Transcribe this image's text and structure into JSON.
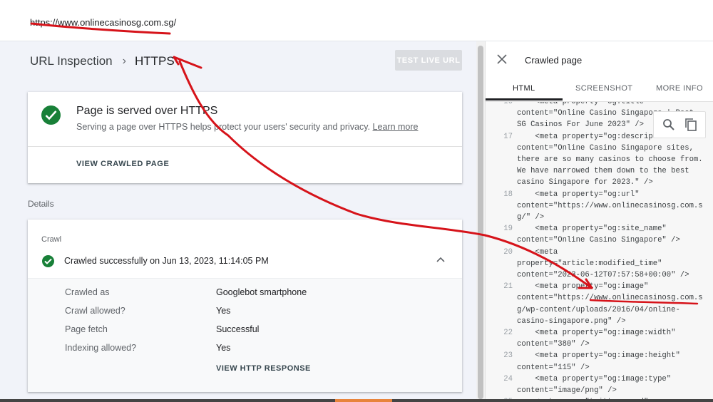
{
  "topbar": {
    "url": "https://www.onlinecasinosg.com.sg/"
  },
  "breadcrumb": {
    "root": "URL Inspection",
    "sep": "›",
    "current": "HTTPS"
  },
  "test_live_url": "TEST LIVE URL",
  "https_card": {
    "title": "Page is served over HTTPS",
    "description": "Serving a page over HTTPS helps protect your users' security and privacy.",
    "learn_more": "Learn more",
    "view_crawled": "VIEW CRAWLED PAGE"
  },
  "details_label": "Details",
  "crawl_card": {
    "label": "Crawl",
    "status": "Crawled successfully on Jun 13, 2023, 11:14:05 PM",
    "rows": [
      {
        "key": "Crawled as",
        "value": "Googlebot smartphone"
      },
      {
        "key": "Crawl allowed?",
        "value": "Yes"
      },
      {
        "key": "Page fetch",
        "value": "Successful"
      },
      {
        "key": "Indexing allowed?",
        "value": "Yes"
      }
    ],
    "view_response": "VIEW HTTP RESPONSE"
  },
  "panel": {
    "title": "Crawled page",
    "tabs": [
      "HTML",
      "SCREENSHOT",
      "MORE INFO"
    ],
    "code_lines": [
      {
        "n": "16",
        "t": "    <meta property=\"og:title\""
      },
      {
        "n": "",
        "t": "content=\"Online Casino Singapore | Best"
      },
      {
        "n": "",
        "t": "SG Casinos For June 2023\" />"
      },
      {
        "n": "17",
        "t": "    <meta property=\"og:description\""
      },
      {
        "n": "",
        "t": "content=\"Online Casino Singapore sites,"
      },
      {
        "n": "",
        "t": "there are so many casinos to choose from."
      },
      {
        "n": "",
        "t": "We have narrowed them down to the best"
      },
      {
        "n": "",
        "t": "casino Singapore for 2023.\" />"
      },
      {
        "n": "18",
        "t": "    <meta property=\"og:url\""
      },
      {
        "n": "",
        "t": "content=\"https://www.onlinecasinosg.com.s"
      },
      {
        "n": "",
        "t": "g/\" />"
      },
      {
        "n": "19",
        "t": "    <meta property=\"og:site_name\""
      },
      {
        "n": "",
        "t": "content=\"Online Casino Singapore\" />"
      },
      {
        "n": "20",
        "t": "    <meta"
      },
      {
        "n": "",
        "t": "property=\"article:modified_time\""
      },
      {
        "n": "",
        "t": "content=\"2023-06-12T07:57:58+00:00\" />"
      },
      {
        "n": "21",
        "t": "    <meta property=\"og:image\""
      },
      {
        "n": "",
        "t": "content=\"https://www.onlinecasinosg.com.s"
      },
      {
        "n": "",
        "t": "g/wp-content/uploads/2016/04/online-"
      },
      {
        "n": "",
        "t": "casino-singapore.png\" />"
      },
      {
        "n": "22",
        "t": "    <meta property=\"og:image:width\""
      },
      {
        "n": "",
        "t": "content=\"380\" />"
      },
      {
        "n": "23",
        "t": "    <meta property=\"og:image:height\""
      },
      {
        "n": "",
        "t": "content=\"115\" />"
      },
      {
        "n": "24",
        "t": "    <meta property=\"og:image:type\""
      },
      {
        "n": "",
        "t": "content=\"image/png\" />"
      },
      {
        "n": "25",
        "t": "    <meta name=\"twitter:card\""
      }
    ]
  },
  "colors": {
    "accent_green": "#188038",
    "annotation_red": "#d6131a"
  }
}
